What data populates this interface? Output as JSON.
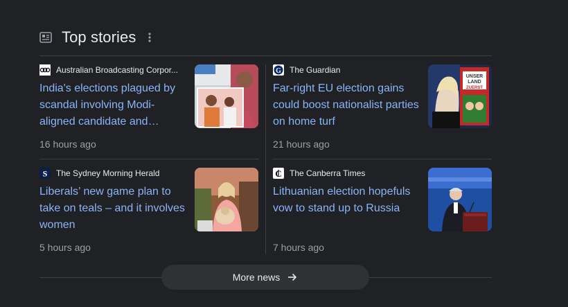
{
  "section": {
    "title": "Top stories",
    "title_icon": "newspaper-icon",
    "menu_icon": "more-vert-icon"
  },
  "stories": [
    {
      "source": "Australian Broadcasting Corpor...",
      "logo_icon": "abc-logo-icon",
      "headline": "India's elections plagued by scandal involving Modi-aligned candidate and…",
      "time": "16 hours ago",
      "thumbnail": "rally-photo"
    },
    {
      "source": "The Guardian",
      "logo_icon": "guardian-logo-icon",
      "headline": "Far-right EU election gains could boost nationalist parties on home turf",
      "time": "21 hours ago",
      "thumbnail": "politician-photo"
    },
    {
      "source": "The Sydney Morning Herald",
      "logo_icon": "smh-logo-icon",
      "headline": "Liberals’ new game plan to take on teals – and it involves women",
      "time": "5 hours ago",
      "thumbnail": "woman-with-dog-photo"
    },
    {
      "source": "The Canberra Times",
      "logo_icon": "canberra-times-logo-icon",
      "headline": "Lithuanian election hopefuls vow to stand up to Russia",
      "time": "7 hours ago",
      "thumbnail": "speaker-at-podium-photo"
    }
  ],
  "more_button": {
    "label": "More news",
    "icon": "arrow-right-icon"
  },
  "colors": {
    "background": "#202124",
    "link": "#8ab4f8",
    "text": "#e8eaed",
    "muted": "#9aa0a6",
    "divider": "#3c4043",
    "button_bg": "#303134"
  }
}
